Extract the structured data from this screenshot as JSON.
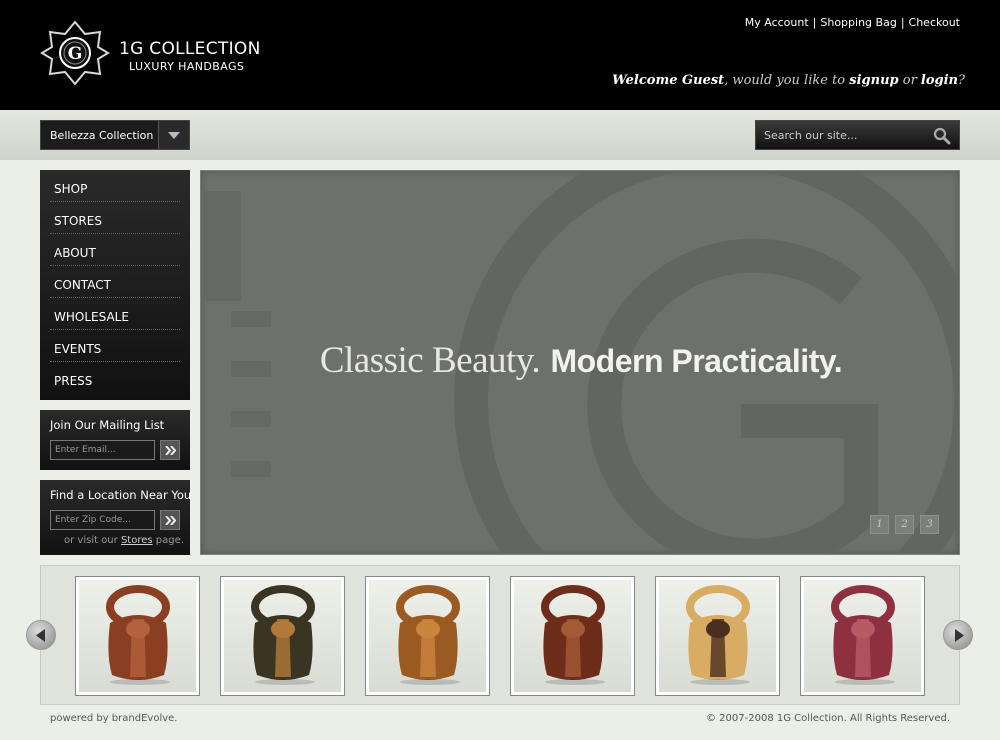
{
  "logo": {
    "emblem_letter": "G",
    "line1": "1G COLLECTION",
    "line2": "LUXURY HANDBAGS"
  },
  "header": {
    "links": [
      "My Account",
      "Shopping Bag",
      "Checkout"
    ],
    "separator": "|",
    "welcome": {
      "greeting": "Welcome Guest",
      "middle": ", would you like to ",
      "signup": "signup",
      "or": " or ",
      "login": "login",
      "end": "?"
    }
  },
  "toolbar": {
    "collection_selected": "Bellezza Collection",
    "search_placeholder": "Search our site..."
  },
  "nav": {
    "items": [
      "SHOP",
      "STORES",
      "ABOUT",
      "CONTACT",
      "WHOLESALE",
      "EVENTS",
      "PRESS"
    ]
  },
  "mailing": {
    "title": "Join Our Mailing List",
    "placeholder": "Enter Email..."
  },
  "locator": {
    "title": "Find a Location Near You",
    "placeholder": "Enter Zip Code...",
    "visit_prefix": "or visit our ",
    "visit_link": "Stores",
    "visit_suffix": " page."
  },
  "hero": {
    "tagline_part1": "Classic Beauty.",
    "tagline_part2": "Modern Practicality.",
    "pages": [
      "1",
      "2",
      "3"
    ]
  },
  "carousel": {
    "products": [
      {
        "color": "#8a3f22",
        "accent": "#b3623e"
      },
      {
        "color": "#3a3422",
        "accent": "#b27a3a"
      },
      {
        "color": "#9a5a22",
        "accent": "#c9853f"
      },
      {
        "color": "#6e2c1a",
        "accent": "#a35a36"
      },
      {
        "color": "#d9ac63",
        "accent": "#4a2f1e"
      },
      {
        "color": "#8e3040",
        "accent": "#b85a66"
      }
    ]
  },
  "footer": {
    "left": "powered by brandEvolve.",
    "right": "© 2007-2008 1G Collection. All Rights Reserved."
  },
  "colors": {
    "header_bg": "#000000",
    "page_bg": "#ecefe8",
    "hero_bg": "#6e706b"
  }
}
